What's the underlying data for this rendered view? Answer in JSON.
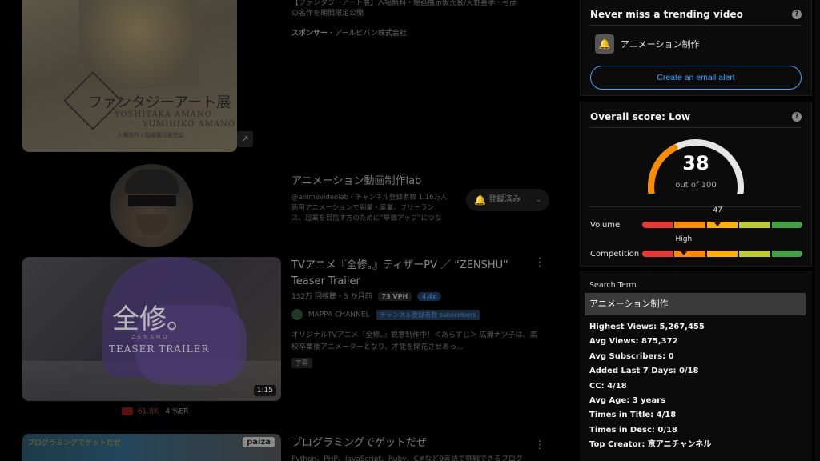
{
  "feed": {
    "ad": {
      "title_line1": "【ファンタジーアート展】入場無料・絵画展示販売会/天野喜孝・弓彦",
      "title_line2": "の名作を期間限定公開",
      "sponsor_prefix": "スポンサー",
      "sponsor_name": "・アールビバン株式会社",
      "thumb_title": "ファンタジーアート展",
      "thumb_sub1": "YOSHITAKA AMANO",
      "thumb_sub2": "YUMIHIKO AMANO",
      "thumb_sub3": "入場無料 / 絵画展示販売会"
    },
    "channel": {
      "name": "アニメーション動画制作lab",
      "meta": "@animevideolab・チャンネル登録者数 1.16万人",
      "desc_line1": "商用アニメーションで副業・案業、フリーラン",
      "desc_line2": "ス、起業を目指す方のために“単価アップ”につな",
      "subscribe_label": "登録済み"
    },
    "video2": {
      "title_line1": "TVアニメ『全修。』ティザーPV ／ “ZENSHU”",
      "title_line2": "Teaser Trailer",
      "stats": "132万 回視聴・5 か月前",
      "vph": "73 VPH",
      "multiplier": "4.4x",
      "channel_name": "MAPPA CHANNEL",
      "channel_tag": "チャンネル登録者数 subscribers",
      "desc_line1": "オリジナルTVアニメ『全修。』鋭意制作中！＜あらすじ＞ 広瀬ナツ子は、高",
      "desc_line2": "校卒業後アニメーターとなり、才能を開花させあっ...",
      "caption_badge": "字幕",
      "duration": "1:15",
      "thumb_kanji": "全修。",
      "thumb_zen": "ZENSHU",
      "thumb_trailer": "TEASER TRAILER",
      "yt_views": "61.8K",
      "er": "4 %ER"
    },
    "video3": {
      "title": "プログラミングでゲットだぜ",
      "desc": "Python、PHP、JavaScript、Ruby、C#など9言語で挑戦できるプログ",
      "brand": "paiza",
      "banner": "プログラミングでゲットだぜ"
    }
  },
  "sidebar": {
    "trending": {
      "title": "Never miss a trending video",
      "alert_term": "アニメーション制作",
      "email_button": "Create an email alert"
    },
    "score": {
      "title": "Overall score: Low",
      "value": "38",
      "out_of": "out of 100",
      "gauge_fraction": 0.38,
      "volume_label": "Volume",
      "volume_value": "47",
      "volume_fraction": 0.47,
      "competition_label": "Competition",
      "competition_value": "High",
      "competition_fraction": 0.26,
      "colors": [
        "#e53935",
        "#fb8c00",
        "#ffb300",
        "#c0ca33",
        "#43a047"
      ],
      "gauge_color": "#fb8c00"
    },
    "search": {
      "label": "Search Term",
      "term": "アニメーション制作",
      "stats": [
        "Highest Views: 5,267,455",
        "Avg Views: 875,372",
        "Avg Subscribers: 0",
        "Added Last 7 Days: 0/18",
        "CC: 4/18",
        "Avg Age: 3 years",
        "Times in Title: 4/18",
        "Times in Desc: 0/18",
        "Top Creator: 京アニチャンネル"
      ]
    }
  }
}
